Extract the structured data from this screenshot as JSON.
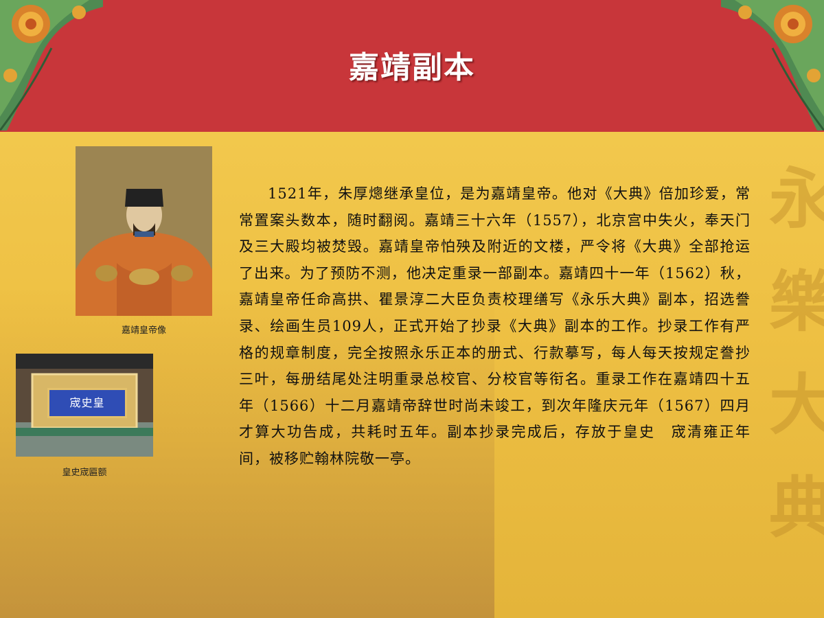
{
  "header": {
    "title": "嘉靖副本"
  },
  "images": {
    "portrait_caption": "嘉靖皇帝像",
    "plaque_caption": "皇史宬匾额",
    "plaque_text": "宬史皇"
  },
  "watermark": {
    "text": "永樂大典"
  },
  "article": {
    "paragraph": "1521年，朱厚熜继承皇位，是为嘉靖皇帝。他对《大典》倍加珍爱，常常置案头数本，随时翻阅。嘉靖三十六年（1557），北京宫中失火，奉天门及三大殿均被焚毁。嘉靖皇帝怕殃及附近的文楼，严令将《大典》全部抢运了出来。为了预防不测，他决定重录一部副本。嘉靖四十一年（1562）秋，嘉靖皇帝任命高拱、瞿景淳二大臣负责校理缮写《永乐大典》副本，招选誊录、绘画生员109人，正式开始了抄录《大典》副本的工作。抄录工作有严格的规章制度，完全按照永乐正本的册式、行款摹写，每人每天按规定誊抄三叶，每册结尾处注明重录总校官、分校官等衔名。重录工作在嘉靖四十五年（1566）十二月嘉靖帝辞世时尚未竣工，到次年隆庆元年（1567）四月才算大功告成，共耗时五年。副本抄录完成后，存放于皇史　宬清雍正年间，被移贮翰林院敬一亭。"
  },
  "colors": {
    "header_red": "#c8363a",
    "body_yellow": "#eec043"
  }
}
